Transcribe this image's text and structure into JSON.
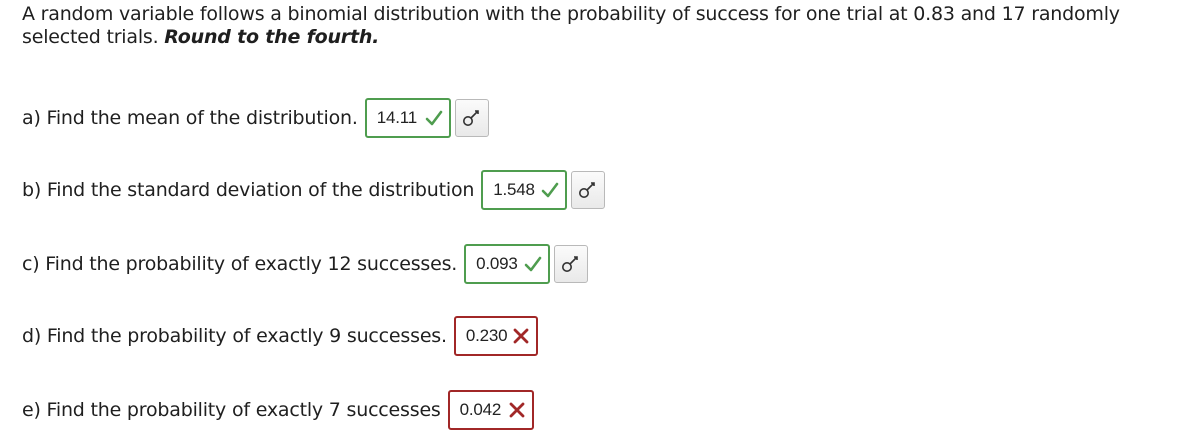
{
  "intro": {
    "text": "A random variable follows a binomial distribution with the probability of success for one trial at 0.83 and 17 randomly selected trials.",
    "instruction": "Round to the fourth."
  },
  "questions": [
    {
      "label": "a) Find the mean of the distribution.",
      "answer": "14.11",
      "status": "correct",
      "status_icon": "checkmark-icon",
      "has_key": true
    },
    {
      "label": "b) Find the standard deviation of the distribution",
      "answer": "1.548",
      "status": "correct",
      "status_icon": "checkmark-icon",
      "has_key": true
    },
    {
      "label": "c) Find the probability of exactly 12 successes.",
      "answer": "0.093",
      "status": "correct",
      "status_icon": "checkmark-icon",
      "has_key": true
    },
    {
      "label": "d) Find the probability of exactly 9 successes.",
      "answer": "0.230",
      "status": "incorrect",
      "status_icon": "x-mark-icon",
      "has_key": false
    },
    {
      "label": "e) Find the probability of exactly 7 successes",
      "answer": "0.042",
      "status": "incorrect",
      "status_icon": "x-mark-icon",
      "has_key": false
    }
  ],
  "key_button_icon": "key-icon",
  "colors": {
    "correct": "#4f9d4f",
    "incorrect": "#a12727",
    "text": "#1f1f1f"
  }
}
